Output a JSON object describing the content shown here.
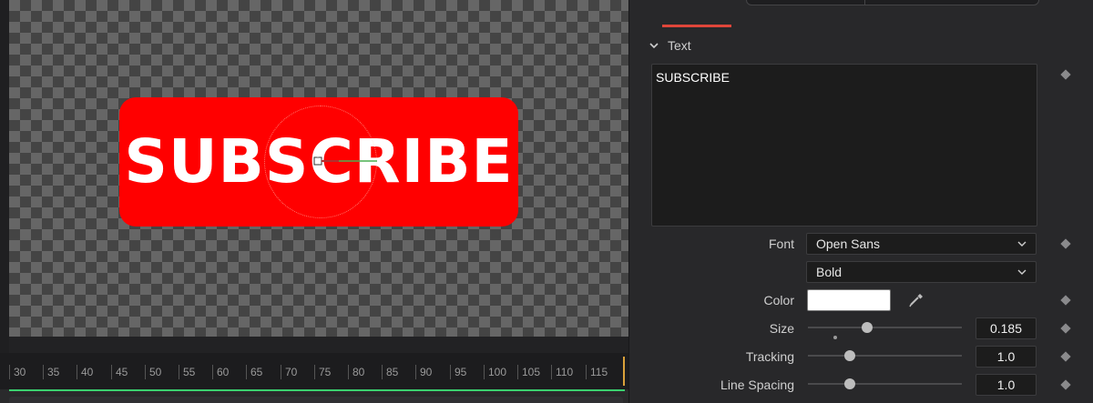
{
  "timeline": {
    "ticks": [
      "30",
      "35",
      "40",
      "45",
      "50",
      "55",
      "60",
      "65",
      "70",
      "75",
      "80",
      "85",
      "90",
      "95",
      "100",
      "105",
      "110",
      "115"
    ]
  },
  "viewer": {
    "preview_text": "SUBSCRIBE",
    "button_color": "#ff0000"
  },
  "inspector": {
    "section_title": "Text",
    "text_value": "SUBSCRIBE",
    "font_label": "Font",
    "font_family": "Open Sans",
    "font_style": "Bold",
    "color_label": "Color",
    "color_value": "#ffffff",
    "size_label": "Size",
    "size_value": "0.185",
    "tracking_label": "Tracking",
    "tracking_value": "1.0",
    "line_spacing_label": "Line Spacing",
    "line_spacing_value": "1.0",
    "accent_color": "#e0463a"
  }
}
